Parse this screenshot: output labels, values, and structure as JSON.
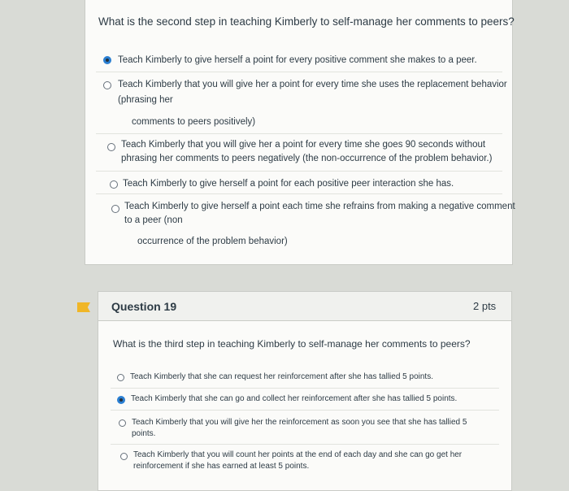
{
  "question18": {
    "prompt": "What is the second step in teaching Kimberly to self-manage her comments to peers?",
    "options": [
      {
        "lines": [
          "Teach Kimberly to give herself a point for every positive comment she makes to a peer."
        ],
        "selected": true
      },
      {
        "lines": [
          "Teach Kimberly that you will give her a point for every time she uses the replacement behavior",
          "(phrasing her",
          "comments to peers positively)"
        ],
        "selected": false
      },
      {
        "lines": [
          "Teach Kimberly that you will give her a point for every time she goes 90 seconds without",
          "phrasing her comments to peers negatively (the non-occurrence of the problem behavior.)"
        ],
        "selected": false
      },
      {
        "lines": [
          "Teach Kimberly to give herself a point for each positive peer interaction she has."
        ],
        "selected": false
      },
      {
        "lines": [
          "Teach Kimberly to give herself a point each time she refrains from making a negative comment",
          "to a peer (non",
          "occurrence of the problem behavior)"
        ],
        "selected": false
      }
    ]
  },
  "question19": {
    "title": "Question 19",
    "points": "2 pts",
    "prompt": "What is the third step in teaching Kimberly to self-manage her comments to peers?",
    "options": [
      {
        "lines": [
          "Teach Kimberly that she can request her reinforcement after she has tallied 5 points."
        ],
        "selected": false
      },
      {
        "lines": [
          "Teach Kimberly that she can go and collect her reinforcement after she has tallied 5 points."
        ],
        "selected": true
      },
      {
        "lines": [
          "Teach Kimberly that you will give her the reinforcement as soon you see that she has tallied 5",
          "points."
        ],
        "selected": false
      },
      {
        "lines": [
          "Teach Kimberly that you will count her points at the end of each day and she can go get her",
          "reinforcement if she has earned at least 5 points."
        ],
        "selected": false
      }
    ]
  },
  "colors": {
    "accent": "#2a7fd2",
    "bookmark": "#f0b627"
  },
  "icons": {
    "bookmark": "bookmark-flag-icon",
    "radio": "radio-button-icon"
  }
}
